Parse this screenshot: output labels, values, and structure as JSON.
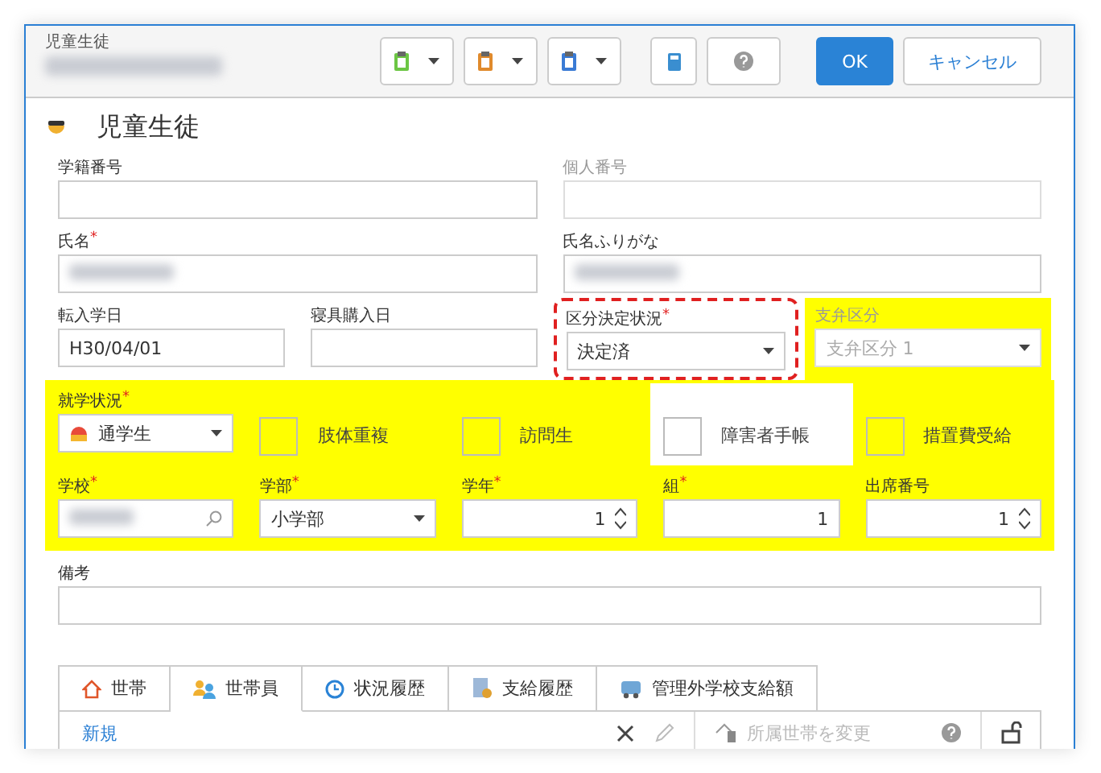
{
  "window": {
    "title": "児童生徒",
    "subtitle_redacted": true
  },
  "toolbar": {
    "clipboards": [
      {
        "color": "#6cc644"
      },
      {
        "color": "#e08a2c"
      },
      {
        "color": "#3a7bd5"
      }
    ],
    "ok": "OK",
    "cancel": "キャンセル"
  },
  "heading": "児童生徒",
  "form": {
    "required_mark": "*",
    "rows": [
      {
        "highlighted": false,
        "fields": [
          {
            "kind": "text",
            "label": "学籍番号",
            "required": false,
            "disabled": false,
            "highlighted": false,
            "outlined": false
          },
          {
            "kind": "text",
            "label": "個人番号",
            "required": false,
            "disabled": true,
            "highlighted": false,
            "outlined": false
          }
        ]
      },
      {
        "highlighted": false,
        "fields": [
          {
            "kind": "text",
            "label": "氏名",
            "required": true,
            "disabled": false,
            "redacted": true,
            "highlighted": false,
            "outlined": false
          },
          {
            "kind": "text",
            "label": "氏名ふりがな",
            "required": false,
            "disabled": false,
            "redacted": true,
            "highlighted": false,
            "outlined": false
          }
        ]
      },
      {
        "highlighted": false,
        "fields": [
          {
            "kind": "text",
            "label": "転入学日",
            "value": "H30/04/01",
            "required": false,
            "disabled": false,
            "highlighted": false,
            "outlined": false
          },
          {
            "kind": "text",
            "label": "寝具購入日",
            "required": false,
            "disabled": false,
            "highlighted": false,
            "outlined": false
          },
          {
            "kind": "select",
            "label": "区分決定状況",
            "value": "決定済",
            "required": true,
            "disabled": false,
            "highlighted": false,
            "outlined": true
          },
          {
            "kind": "select",
            "label": "支弁区分",
            "value": "支弁区分 1",
            "required": false,
            "disabled": true,
            "highlighted": true,
            "outlined": false
          }
        ]
      },
      {
        "highlighted": true,
        "fields": [
          {
            "kind": "select",
            "label": "就学状況",
            "value": "通学生",
            "icon": true,
            "required": true,
            "disabled": false,
            "highlighted": true,
            "outlined": false
          },
          {
            "kind": "checkbox",
            "label": "肢体重複",
            "checked": false,
            "highlighted": true
          },
          {
            "kind": "checkbox",
            "label": "訪問生",
            "checked": false,
            "highlighted": true
          },
          {
            "kind": "checkbox",
            "label": "障害者手帳",
            "checked": false,
            "highlighted": false
          },
          {
            "kind": "checkbox",
            "label": "措置費受給",
            "checked": false,
            "highlighted": true
          }
        ]
      },
      {
        "highlighted": true,
        "fields": [
          {
            "kind": "search",
            "label": "学校",
            "redacted": true,
            "required": true,
            "disabled": false,
            "highlighted": true,
            "outlined": false
          },
          {
            "kind": "select",
            "label": "学部",
            "value": "小学部",
            "required": true,
            "disabled": false,
            "highlighted": true,
            "outlined": false
          },
          {
            "kind": "spin",
            "label": "学年",
            "value": "1",
            "required": true,
            "disabled": false,
            "highlighted": true,
            "outlined": false
          },
          {
            "kind": "number",
            "label": "組",
            "value": "1",
            "required": true,
            "disabled": false,
            "highlighted": true,
            "outlined": false
          },
          {
            "kind": "spin",
            "label": "出席番号",
            "value": "1",
            "required": false,
            "disabled": false,
            "highlighted": true,
            "outlined": false
          }
        ]
      },
      {
        "highlighted": false,
        "fields": [
          {
            "kind": "text",
            "label": "備考",
            "required": false,
            "disabled": false,
            "highlighted": false,
            "outlined": false
          }
        ]
      }
    ]
  },
  "tabs": [
    {
      "label": "世帯",
      "kind": "house",
      "selected": false
    },
    {
      "label": "世帯員",
      "kind": "people",
      "selected": true
    },
    {
      "label": "状況履歴",
      "kind": "clock",
      "selected": false
    },
    {
      "label": "支給履歴",
      "kind": "ledger",
      "selected": false
    },
    {
      "label": "管理外学校支給額",
      "kind": "bus",
      "selected": false
    }
  ],
  "panel": {
    "new": "新規",
    "change": {
      "label": "所属世帯を変更",
      "disabled": true
    },
    "edit_disabled": true
  }
}
